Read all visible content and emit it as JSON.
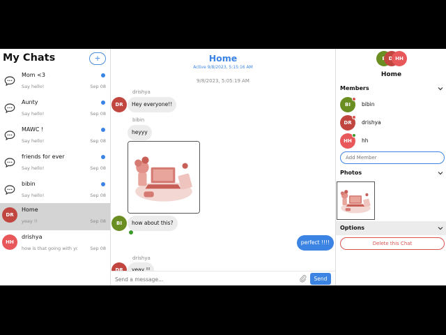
{
  "sidebar": {
    "title": "My Chats",
    "add_label": "+",
    "chats": [
      {
        "name": "Mom <3",
        "preview": "Say hello!",
        "date": "Sep 08",
        "unread": true
      },
      {
        "name": "Aunty",
        "preview": "Say hello!",
        "date": "Sep 08",
        "unread": true
      },
      {
        "name": "MAWC !",
        "preview": "Say hello!",
        "date": "Sep 08",
        "unread": true
      },
      {
        "name": "friends for ever",
        "preview": "Say hello!",
        "date": "Sep 08",
        "unread": true
      },
      {
        "name": "bibin",
        "preview": "Say hello!",
        "date": "Sep 08",
        "unread": true
      },
      {
        "name": "Home",
        "preview": "yeay !!",
        "date": "Sep 08",
        "initials": "DR",
        "active": true
      },
      {
        "name": "drishya",
        "preview": "how is that going with yo",
        "date": "Sep 08",
        "initials": "HH"
      }
    ]
  },
  "chat": {
    "title": "Home",
    "active_status": "Active 9/8/2023, 5:15:16 AM",
    "date_separator": "9/8/2023, 5:05:19 AM",
    "messages": [
      {
        "sender": "drishya",
        "initials": "DR",
        "text": "Hey everyone!!"
      },
      {
        "sender": "bibin",
        "text": "heyyy"
      },
      {
        "initials": "BI",
        "text": "how about this?"
      },
      {
        "text": "perfect !!!!"
      },
      {
        "sender": "drishya",
        "initials": "DR",
        "text": "yeay !!"
      }
    ],
    "input_placeholder": "Send a message...",
    "send_label": "Send"
  },
  "details": {
    "group_initials": [
      "B",
      "DI",
      "HH"
    ],
    "title": "Home",
    "members_label": "Members",
    "members": [
      {
        "initials": "BI",
        "name": "bibin"
      },
      {
        "initials": "DR",
        "name": "drishya"
      },
      {
        "initials": "HH",
        "name": "hh"
      }
    ],
    "add_member_placeholder": "Add Member",
    "photos_label": "Photos",
    "options_label": "Options",
    "delete_label": "Delete this Chat"
  },
  "colors": {
    "accent": "#3b84e3",
    "avatar_bi": "#6b8e23",
    "avatar_dr": "#c0463f",
    "avatar_hh": "#e8585a",
    "status_online": "#3c9a2d",
    "status_away": "#d9534f",
    "danger": "#d9534f"
  },
  "icons": {
    "chat": "chat-bubble-icon",
    "attach": "paperclip-icon",
    "chevron": "chevron-down-icon"
  }
}
